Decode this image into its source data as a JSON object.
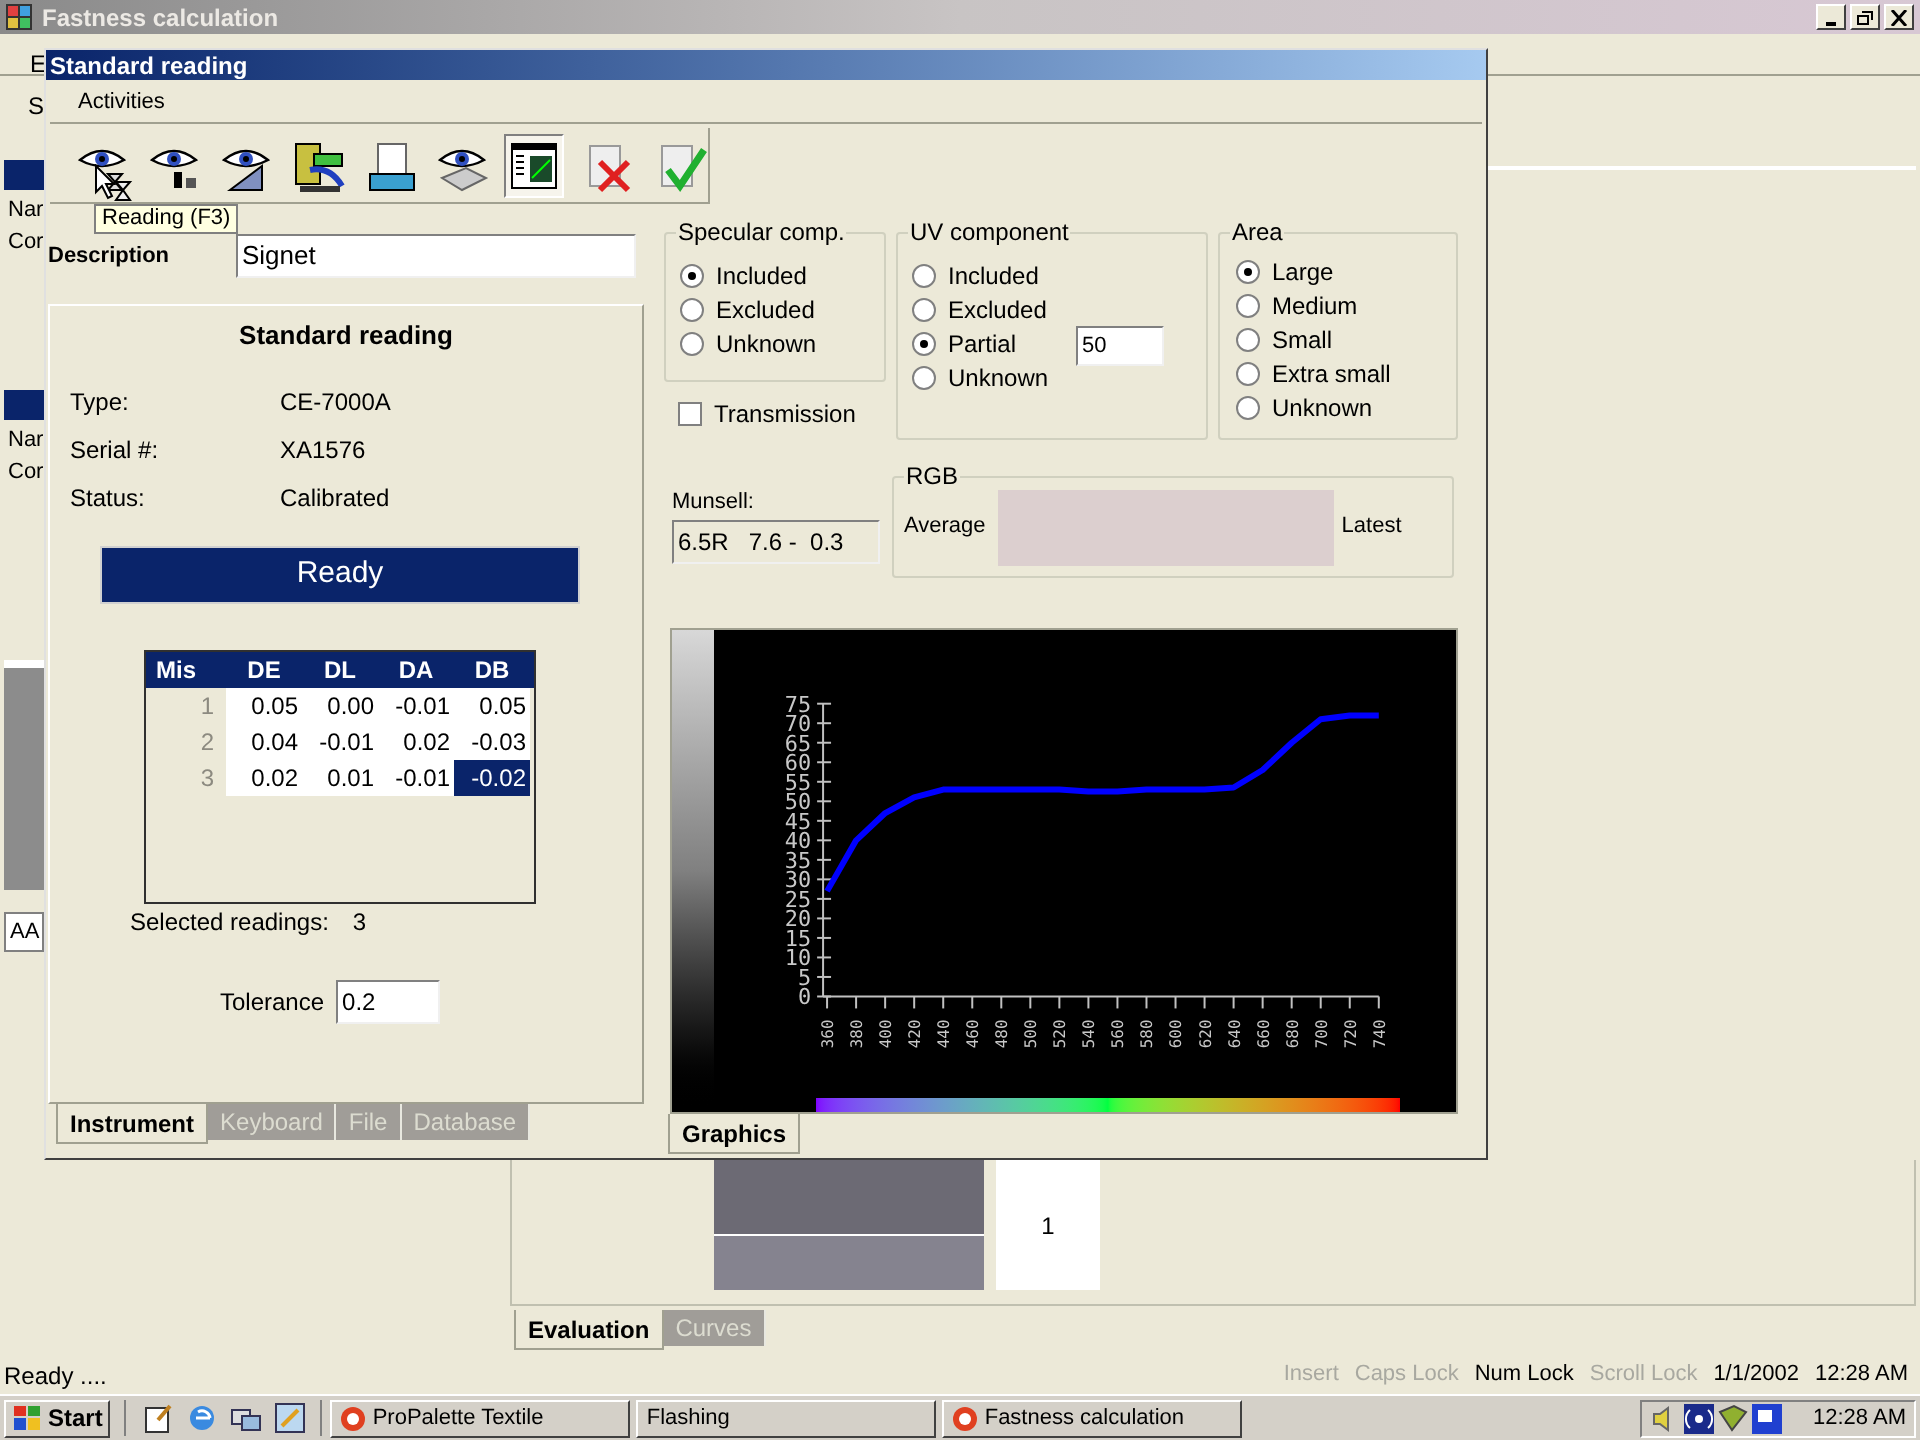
{
  "main_window": {
    "title": "Fastness calculation",
    "menu_letters": [
      "E",
      "S"
    ],
    "labels": [
      "Nar",
      "Cor",
      "Nar",
      "Cor"
    ],
    "field_value": "AA",
    "grid_cell": "1",
    "tabs": [
      {
        "label": "Evaluation",
        "selected": true
      },
      {
        "label": "Curves",
        "selected": false
      }
    ]
  },
  "dialog": {
    "title": "Standard reading",
    "menu": [
      "Activities"
    ],
    "toolbar": [
      {
        "kind": "eye-hourglass",
        "pressed": false
      },
      {
        "kind": "eye-instrument",
        "pressed": false
      },
      {
        "kind": "eye-ruler",
        "pressed": false
      },
      {
        "kind": "instrument",
        "pressed": false
      },
      {
        "kind": "tray",
        "pressed": false
      },
      {
        "kind": "eye-keyboard",
        "pressed": false
      },
      {
        "kind": "chart",
        "pressed": true
      },
      {
        "kind": "cancel",
        "pressed": false
      },
      {
        "kind": "confirm",
        "pressed": false
      }
    ],
    "tooltip": "Reading (F3)",
    "description": {
      "label": "Description",
      "value": "Signet"
    },
    "instrument": {
      "heading": "Standard reading",
      "fields": [
        {
          "label": "Type:",
          "value": "CE-7000A"
        },
        {
          "label": "Serial #:",
          "value": "XA1576"
        },
        {
          "label": "Status:",
          "value": "Calibrated"
        }
      ],
      "status_banner": "Ready",
      "table": {
        "columns": [
          "Mis",
          "DE",
          "DL",
          "DA",
          "DB"
        ],
        "rows": [
          {
            "cells": [
              {
                "text": "1",
                "selected": false
              },
              {
                "text": "0.05",
                "selected": false
              },
              {
                "text": "0.00",
                "selected": false
              },
              {
                "text": "-0.01",
                "selected": false
              },
              {
                "text": "0.05",
                "selected": false
              }
            ]
          },
          {
            "cells": [
              {
                "text": "2",
                "selected": false
              },
              {
                "text": "0.04",
                "selected": false
              },
              {
                "text": "-0.01",
                "selected": false
              },
              {
                "text": "0.02",
                "selected": false
              },
              {
                "text": "-0.03",
                "selected": false
              }
            ]
          },
          {
            "cells": [
              {
                "text": "3",
                "selected": false
              },
              {
                "text": "0.02",
                "selected": false
              },
              {
                "text": "0.01",
                "selected": false
              },
              {
                "text": "-0.01",
                "selected": false
              },
              {
                "text": "-0.02",
                "selected": true
              }
            ]
          }
        ]
      },
      "selected_readings": {
        "label": "Selected readings:",
        "value": "3"
      },
      "tolerance": {
        "label": "Tolerance",
        "value": "0.2"
      }
    },
    "left_tabs": [
      {
        "label": "Instrument",
        "selected": true
      },
      {
        "label": "Keyboard",
        "selected": false
      },
      {
        "label": "File",
        "selected": false
      },
      {
        "label": "Database",
        "selected": false
      }
    ],
    "specular": {
      "title": "Specular comp.",
      "options": [
        {
          "label": "Included",
          "selected": true
        },
        {
          "label": "Excluded",
          "selected": false
        },
        {
          "label": "Unknown",
          "selected": false
        }
      ]
    },
    "transmission": {
      "label": "Transmission",
      "checked": false
    },
    "uv": {
      "title": "UV component",
      "options": [
        {
          "label": "Included",
          "selected": false
        },
        {
          "label": "Excluded",
          "selected": false
        },
        {
          "label": "Partial",
          "selected": true
        },
        {
          "label": "Unknown",
          "selected": false
        }
      ],
      "value": "50"
    },
    "area": {
      "title": "Area",
      "options": [
        {
          "label": "Large",
          "selected": true
        },
        {
          "label": "Medium",
          "selected": false
        },
        {
          "label": "Small",
          "selected": false
        },
        {
          "label": "Extra small",
          "selected": false
        },
        {
          "label": "Unknown",
          "selected": false
        }
      ]
    },
    "munsell": {
      "label": "Munsell:",
      "value": "6.5R   7.6 -  0.3"
    },
    "rgb": {
      "title": "RGB",
      "average_label": "Average",
      "latest_label": "Latest"
    },
    "chart_data": {
      "type": "line",
      "x": [
        360,
        380,
        400,
        420,
        440,
        460,
        480,
        500,
        520,
        540,
        560,
        580,
        600,
        620,
        640,
        660,
        680,
        700,
        720,
        740
      ],
      "series": [
        {
          "color": "#0000ff",
          "values": [
            27,
            40,
            47,
            51,
            53,
            53,
            53,
            53,
            53,
            52.5,
            52.5,
            53,
            53,
            53,
            53.5,
            58,
            65,
            71,
            72,
            72
          ]
        }
      ],
      "xlim": [
        360,
        740
      ],
      "ylim": [
        0,
        75
      ],
      "xticks": [
        360,
        380,
        400,
        420,
        440,
        460,
        480,
        500,
        520,
        540,
        560,
        580,
        600,
        620,
        640,
        660,
        680,
        700,
        720,
        740
      ],
      "yticks": [
        0,
        5,
        10,
        15,
        20,
        25,
        30,
        35,
        40,
        45,
        50,
        55,
        60,
        65,
        70,
        75
      ]
    },
    "right_tabs": [
      {
        "label": "Graphics",
        "selected": true
      }
    ]
  },
  "status_bar": {
    "message": "Ready ....",
    "indicators": [
      {
        "label": "Insert",
        "on": false
      },
      {
        "label": "Caps Lock",
        "on": false
      },
      {
        "label": "Num Lock",
        "on": true
      },
      {
        "label": "Scroll Lock",
        "on": false
      }
    ],
    "date": "1/1/2002",
    "time": "12:28 AM"
  },
  "taskbar": {
    "start": "Start",
    "tasks": [
      "ProPalette Textile",
      "Flashing",
      "Fastness calculation"
    ],
    "clock": "12:28 AM"
  }
}
